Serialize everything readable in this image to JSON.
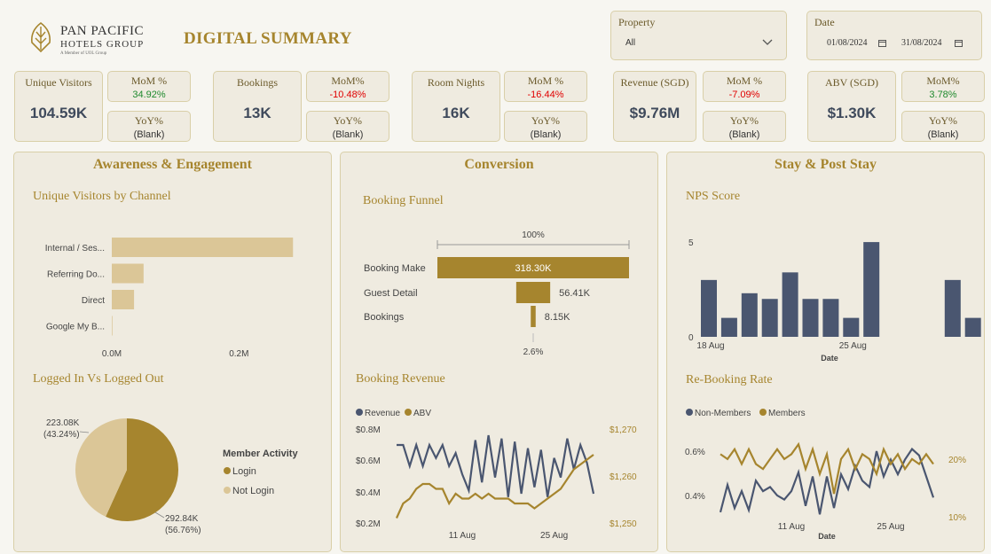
{
  "brand": {
    "line1": "Pan Pacific",
    "line2": "Hotels Group",
    "line3": "A Member of UOL Group"
  },
  "title": "DIGITAL SUMMARY",
  "filters": {
    "property": {
      "label": "Property",
      "value": "All"
    },
    "date": {
      "label": "Date",
      "start": "01/08/2024",
      "end": "31/08/2024"
    }
  },
  "kpis": [
    {
      "label": "Unique Visitors",
      "value": "104.59K",
      "mom_label": "MoM %",
      "mom": "34.92%",
      "mom_dir": "pos",
      "yoy_label": "YoY%",
      "yoy": "(Blank)"
    },
    {
      "label": "Bookings",
      "value": "13K",
      "mom_label": "MoM%",
      "mom": "-10.48%",
      "mom_dir": "neg",
      "yoy_label": "YoY%",
      "yoy": "(Blank)"
    },
    {
      "label": "Room Nights",
      "value": "16K",
      "mom_label": "MoM %",
      "mom": "-16.44%",
      "mom_dir": "neg",
      "yoy_label": "YoY%",
      "yoy": "(Blank)"
    },
    {
      "label": "Revenue (SGD)",
      "value": "$9.76M",
      "mom_label": "MoM %",
      "mom": "-7.09%",
      "mom_dir": "neg",
      "yoy_label": "YoY%",
      "yoy": "(Blank)"
    },
    {
      "label": "ABV (SGD)",
      "value": "$1.30K",
      "mom_label": "MoM%",
      "mom": "3.78%",
      "mom_dir": "pos",
      "yoy_label": "YoY%",
      "yoy": "(Blank)"
    }
  ],
  "sections": {
    "awareness": "Awareness & Engagement",
    "conversion": "Conversion",
    "stay": "Stay & Post Stay"
  },
  "colors": {
    "gold": "#a6852e",
    "light_gold": "#dbc697",
    "navy": "#4a5670",
    "panel": "#efebe0"
  },
  "chart_data": [
    {
      "id": "unique_visitors_by_channel",
      "type": "bar",
      "orientation": "horizontal",
      "title": "Unique Visitors by Channel",
      "categories": [
        "Internal / Ses...",
        "Referring Do...",
        "Direct",
        "Google My B..."
      ],
      "values": [
        285000,
        50000,
        35000,
        1000
      ],
      "xticks": [
        {
          "value": 0,
          "label": "0.0M"
        },
        {
          "value": 200000,
          "label": "0.2M"
        }
      ],
      "xlim": [
        0,
        300000
      ],
      "color": "#dbc697"
    },
    {
      "id": "logged_in_vs_out",
      "type": "pie",
      "title": "Logged In Vs Logged Out",
      "legend_title": "Member Activity",
      "slices": [
        {
          "name": "Login",
          "value": 292840,
          "label": "292.84K",
          "pct": "(56.76%)",
          "color": "#a6852e"
        },
        {
          "name": "Not Login",
          "value": 223080,
          "label": "223.08K",
          "pct": "(43.24%)",
          "color": "#dbc697"
        }
      ]
    },
    {
      "id": "booking_funnel",
      "type": "bar",
      "subtype": "funnel",
      "title": "Booking Funnel",
      "top_label": "100%",
      "bottom_label": "2.6%",
      "stages": [
        {
          "name": "Booking Make",
          "value": 318300,
          "label": "318.30K"
        },
        {
          "name": "Guest Detail",
          "value": 56410,
          "label": "56.41K"
        },
        {
          "name": "Bookings",
          "value": 8150,
          "label": "8.15K"
        }
      ],
      "color": "#a6852e"
    },
    {
      "id": "booking_revenue",
      "type": "line",
      "title": "Booking Revenue",
      "x": [
        "2024-08-01",
        "2024-08-02",
        "2024-08-03",
        "2024-08-04",
        "2024-08-05",
        "2024-08-06",
        "2024-08-07",
        "2024-08-08",
        "2024-08-09",
        "2024-08-10",
        "2024-08-11",
        "2024-08-12",
        "2024-08-13",
        "2024-08-14",
        "2024-08-15",
        "2024-08-16",
        "2024-08-17",
        "2024-08-18",
        "2024-08-19",
        "2024-08-20",
        "2024-08-21",
        "2024-08-22",
        "2024-08-23",
        "2024-08-24",
        "2024-08-25",
        "2024-08-26",
        "2024-08-27",
        "2024-08-28",
        "2024-08-29",
        "2024-08-30",
        "2024-08-31"
      ],
      "xticks": [
        {
          "value": "2024-08-11",
          "label": "11 Aug"
        },
        {
          "value": "2024-08-25",
          "label": "25 Aug"
        }
      ],
      "series": [
        {
          "name": "Revenue",
          "axis": "left",
          "color": "#4a5670",
          "values": [
            0.68,
            0.68,
            0.55,
            0.68,
            0.55,
            0.68,
            0.6,
            0.68,
            0.55,
            0.63,
            0.5,
            0.4,
            0.71,
            0.45,
            0.74,
            0.48,
            0.72,
            0.36,
            0.7,
            0.38,
            0.66,
            0.42,
            0.65,
            0.36,
            0.6,
            0.48,
            0.72,
            0.53,
            0.68,
            0.57,
            0.38
          ]
        },
        {
          "name": "ABV",
          "axis": "right",
          "color": "#a6852e",
          "values": [
            1251,
            1254,
            1255,
            1257,
            1258,
            1258,
            1257,
            1257,
            1254,
            1256,
            1255,
            1255,
            1256,
            1255,
            1256,
            1255,
            1255,
            1255,
            1254,
            1254,
            1254,
            1253,
            1254,
            1255,
            1256,
            1257,
            1259,
            1261,
            1262,
            1263,
            1264
          ]
        }
      ],
      "yleft": {
        "ticks": [
          "$0.2M",
          "$0.4M",
          "$0.6M",
          "$0.8M"
        ],
        "range": [
          0.2,
          0.8
        ]
      },
      "yright": {
        "ticks": [
          "$1,250",
          "$1,260",
          "$1,270"
        ],
        "range": [
          1250,
          1270
        ]
      }
    },
    {
      "id": "nps_score",
      "type": "bar",
      "title": "NPS Score",
      "xlabel": "Date",
      "x": [
        "2024-08-18",
        "2024-08-19",
        "2024-08-20",
        "2024-08-21",
        "2024-08-22",
        "2024-08-23",
        "2024-08-24",
        "2024-08-25",
        "2024-08-26",
        "2024-08-27",
        "2024-08-28",
        "2024-08-29",
        "2024-08-30",
        "2024-08-31"
      ],
      "values": [
        3,
        1,
        2.3,
        2,
        3.4,
        2,
        2,
        1,
        5,
        null,
        null,
        null,
        3,
        1
      ],
      "xticks": [
        {
          "value": "2024-08-18",
          "label": "18 Aug"
        },
        {
          "value": "2024-08-25",
          "label": "25 Aug"
        }
      ],
      "yticks": [
        0,
        5
      ],
      "ylim": [
        0,
        5.8
      ],
      "color": "#4a5670"
    },
    {
      "id": "rebooking_rate",
      "type": "line",
      "title": "Re-Booking Rate",
      "xlabel": "Date",
      "x": [
        "2024-08-01",
        "2024-08-02",
        "2024-08-03",
        "2024-08-04",
        "2024-08-05",
        "2024-08-06",
        "2024-08-07",
        "2024-08-08",
        "2024-08-09",
        "2024-08-10",
        "2024-08-11",
        "2024-08-12",
        "2024-08-13",
        "2024-08-14",
        "2024-08-15",
        "2024-08-16",
        "2024-08-17",
        "2024-08-18",
        "2024-08-19",
        "2024-08-20",
        "2024-08-21",
        "2024-08-22",
        "2024-08-23",
        "2024-08-24",
        "2024-08-25",
        "2024-08-26",
        "2024-08-27",
        "2024-08-28",
        "2024-08-29",
        "2024-08-30",
        "2024-08-31"
      ],
      "xticks": [
        {
          "value": "2024-08-11",
          "label": "11 Aug"
        },
        {
          "value": "2024-08-25",
          "label": "25 Aug"
        }
      ],
      "series": [
        {
          "name": "Non-Members",
          "axis": "left",
          "color": "#4a5670",
          "values": [
            0.33,
            0.46,
            0.35,
            0.43,
            0.34,
            0.48,
            0.43,
            0.45,
            0.41,
            0.39,
            0.43,
            0.52,
            0.36,
            0.5,
            0.32,
            0.5,
            0.35,
            0.51,
            0.44,
            0.55,
            0.48,
            0.45,
            0.62,
            0.5,
            0.58,
            0.51,
            0.58,
            0.63,
            0.6,
            0.5,
            0.4
          ]
        },
        {
          "name": "Members",
          "axis": "right",
          "color": "#a6852e",
          "values": [
            21,
            20,
            22,
            19,
            22,
            19,
            18,
            20,
            22,
            20,
            21,
            23,
            18,
            22,
            17,
            21,
            13,
            20,
            22,
            18,
            21,
            20,
            17,
            22,
            19,
            21,
            18,
            20,
            19,
            21,
            19
          ]
        }
      ],
      "yleft": {
        "ticks": [
          "0.4%",
          "0.6%"
        ],
        "range": [
          0.3,
          0.7
        ]
      },
      "yright": {
        "ticks": [
          "10%",
          "20%"
        ],
        "range": [
          8,
          25
        ]
      }
    }
  ]
}
